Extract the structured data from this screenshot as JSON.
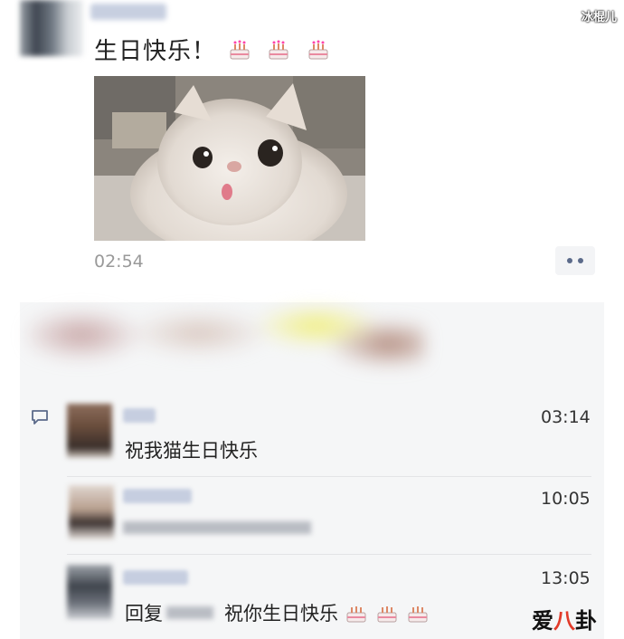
{
  "post": {
    "text": "生日快乐！",
    "cakes": 3,
    "time": "02:54"
  },
  "comments": [
    {
      "time": "03:14",
      "text": "祝我猫生日快乐"
    },
    {
      "time": "10:05"
    },
    {
      "time": "13:05",
      "prefix": "回复",
      "text": "祝你生日快乐",
      "cakes": 3
    }
  ],
  "watermarks": {
    "top": "冰棍儿",
    "bottom_1": "爱",
    "bottom_2": "八",
    "bottom_3": "卦"
  },
  "colors": {
    "link_name": "#c6cee0",
    "panel_bg": "#f5f6f7",
    "more_dot": "#5b6a8a"
  },
  "icons": [
    "cake-icon",
    "comment-icon",
    "more-dots-icon"
  ]
}
